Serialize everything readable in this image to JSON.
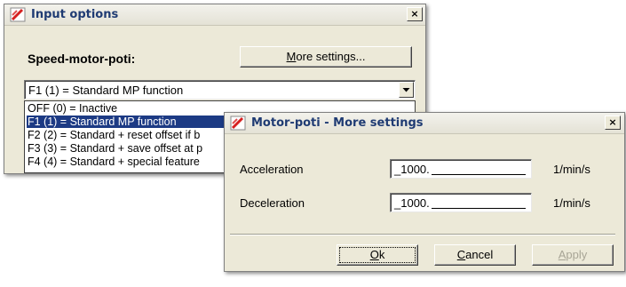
{
  "input_options": {
    "title": "Input options",
    "close_glyph": "×",
    "section_label": "Speed-motor-poti:",
    "more_settings_button": {
      "mnemonic": "M",
      "rest": "ore settings..."
    },
    "select_value": "F1 (1) = Standard MP function",
    "options": [
      "OFF (0) = Inactive",
      "F1 (1) = Standard MP function",
      "F2 (2) = Standard + reset offset if b",
      "F3 (3) = Standard + save offset at p",
      "F4 (4) = Standard + special feature"
    ],
    "selected_index": 1
  },
  "more_settings": {
    "title": "Motor-poti - More settings",
    "close_glyph": "×",
    "fields": [
      {
        "label": "Acceleration",
        "value": "_1000.",
        "unit": "1/min/s"
      },
      {
        "label": "Deceleration",
        "value": "_1000.",
        "unit": "1/min/s"
      }
    ],
    "ok_button": {
      "mnemonic": "O",
      "rest": "k"
    },
    "cancel_button": {
      "mnemonic": "C",
      "rest": "ancel"
    },
    "apply_button": {
      "mnemonic": "A",
      "rest": "pply"
    }
  },
  "colors": {
    "dialog_bg": "#ece9d8",
    "title_text": "#1f3b73",
    "selection": "#1c3a84"
  },
  "icons": [
    "app-icon",
    "close-icon",
    "dropdown-arrow-icon"
  ]
}
